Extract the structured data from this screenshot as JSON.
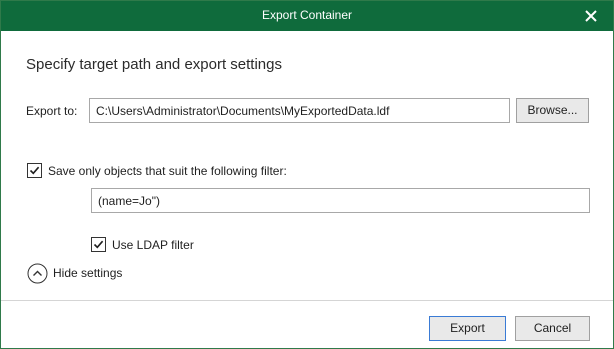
{
  "window": {
    "title": "Export Container"
  },
  "dialog": {
    "heading": "Specify target path and export settings",
    "export_label": "Export to:",
    "export_path": "C:\\Users\\Administrator\\Documents\\MyExportedData.ldf",
    "browse_label": "Browse...",
    "filter_checkbox": {
      "label": "Save only objects that suit the following filter:",
      "checked": true
    },
    "filter_value": "(name=Jo\")",
    "ldap_checkbox": {
      "label": "Use LDAP filter",
      "checked": true
    },
    "toggle_label": "Hide settings",
    "toggle_icon": "chevron-up-circle-icon"
  },
  "footer": {
    "export_label": "Export",
    "cancel_label": "Cancel"
  },
  "colors": {
    "titlebar": "#0f6b3c",
    "default_button_border": "#3a7bd5"
  }
}
